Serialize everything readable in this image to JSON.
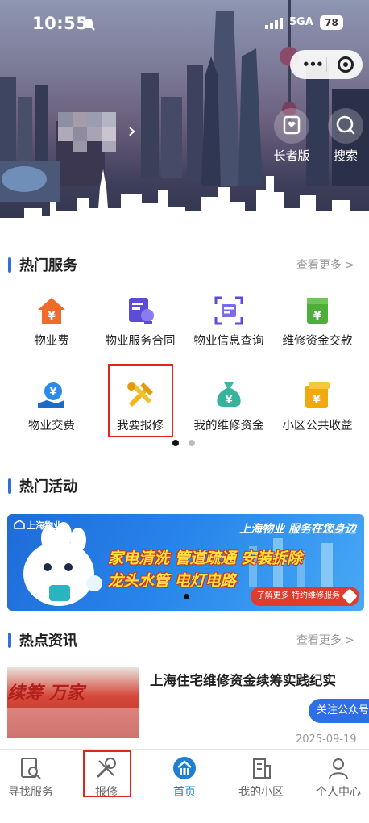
{
  "status_bar": {
    "time": "10:55",
    "network": "5GA",
    "battery": "78"
  },
  "header_tools": {
    "elder_label": "长者版",
    "search_label": "搜索"
  },
  "hot_services": {
    "title": "热门服务",
    "more": "查看更多 >",
    "items": [
      {
        "label": "物业费",
        "icon": "house-yen-icon"
      },
      {
        "label": "物业服务合同",
        "icon": "contract-icon"
      },
      {
        "label": "物业信息查询",
        "icon": "scan-query-icon"
      },
      {
        "label": "维修资金交款",
        "icon": "yen-card-icon"
      },
      {
        "label": "物业交费",
        "icon": "hand-yen-icon"
      },
      {
        "label": "我要报修",
        "icon": "repair-tools-icon"
      },
      {
        "label": "我的维修资金",
        "icon": "money-bag-icon"
      },
      {
        "label": "小区公共收益",
        "icon": "wallet-yen-icon"
      }
    ],
    "page_indicator": {
      "total": 2,
      "active": 1
    }
  },
  "hot_activities": {
    "title": "热门活动",
    "banner": {
      "brand": "上海物业",
      "slogan": "上海物业 服务在您身边",
      "line1": "家电清洗 管道疏通 安装拆除",
      "line2": "龙头水管 电灯电路",
      "button": "了解更多 特约维修服务"
    }
  },
  "hot_news": {
    "title": "热点资讯",
    "more": "查看更多 >",
    "item": {
      "title": "上海住宅维修资金续筹实践纪实",
      "image_text": "续筹 万家",
      "follow_button": "关注公众号",
      "date": "2025-09-19"
    }
  },
  "tab_bar": {
    "items": [
      {
        "label": "寻找服务",
        "icon": "find-service-icon"
      },
      {
        "label": "报修",
        "icon": "wrench-icon"
      },
      {
        "label": "首页",
        "icon": "home-icon"
      },
      {
        "label": "我的小区",
        "icon": "building-icon"
      },
      {
        "label": "个人中心",
        "icon": "person-icon"
      }
    ],
    "active": "首页"
  },
  "colors": {
    "accent": "#2f6fe6",
    "highlight_box": "#e1251b",
    "tab_active": "#1e7fd6"
  }
}
